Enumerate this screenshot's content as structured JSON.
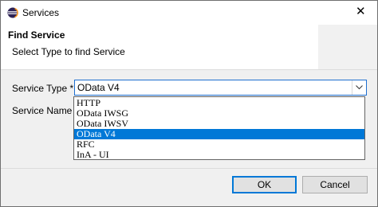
{
  "window": {
    "title": "Services",
    "close_glyph": "✕",
    "app_icon": "eclipse-icon"
  },
  "header": {
    "title": "Find Service",
    "message": "Select Type to find Service"
  },
  "form": {
    "service_type_label": "Service Type *",
    "service_type_value": "OData V4",
    "service_name_label": "Service Name *",
    "options": [
      "HTTP",
      "OData IWSG",
      "OData IWSV",
      "OData V4",
      "RFC",
      "InA - UI"
    ],
    "selected_option": "OData V4"
  },
  "buttons": {
    "ok": "OK",
    "cancel": "Cancel"
  },
  "colors": {
    "selection": "#0078d7",
    "focus_border": "#1e6fd0",
    "dialog_bg": "#f0f0f0"
  }
}
